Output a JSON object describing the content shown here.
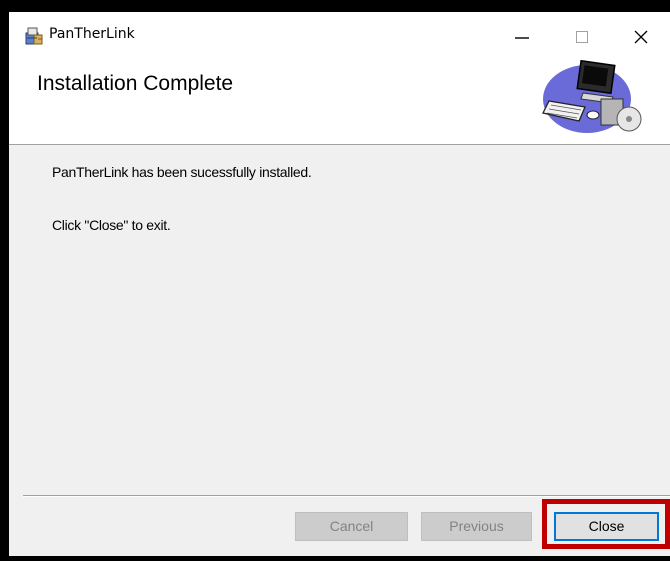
{
  "window": {
    "title": "PanTherLink",
    "app_icon": "installer-package-icon",
    "controls": {
      "minimize_icon": "minimize-icon",
      "maximize_icon": "maximize-icon",
      "close_icon": "close-icon"
    }
  },
  "header": {
    "title": "Installation Complete",
    "art_icon": "computer-cd-icon"
  },
  "body": {
    "message": "PanTherLink has been sucessfully installed.",
    "instruction": "Click \"Close\" to exit."
  },
  "footer": {
    "cancel_label": "Cancel",
    "previous_label": "Previous",
    "close_label": "Close",
    "highlight_color": "#c00000",
    "focus_color": "#0078d7"
  }
}
